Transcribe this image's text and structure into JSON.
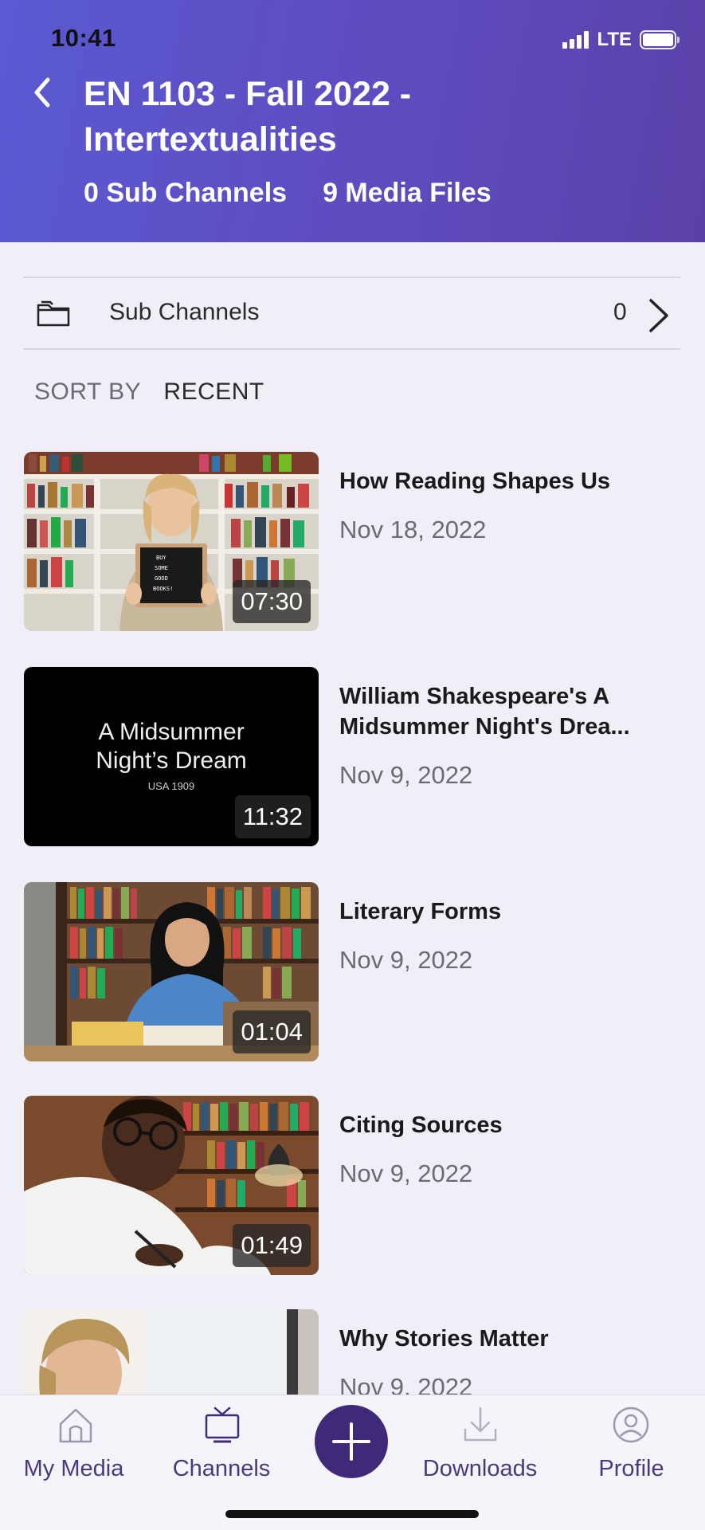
{
  "status_bar": {
    "time": "10:41",
    "network": "LTE"
  },
  "header": {
    "title": "EN 1103 - Fall 2022 - Intertextualities",
    "sub_channels_count_text": "0 Sub Channels",
    "media_files_count_text": "9 Media Files"
  },
  "sub_channels": {
    "label": "Sub Channels",
    "count": "0"
  },
  "sort": {
    "label": "SORT BY",
    "value": "RECENT"
  },
  "media": [
    {
      "title": "How Reading Shapes Us",
      "date": "Nov 18, 2022",
      "duration": "07:30"
    },
    {
      "title": "William Shakespeare's A Midsummer Night's Drea...",
      "date": "Nov 9, 2022",
      "duration": "11:32",
      "thumb_text": "A Midsummer Night’s Dream",
      "thumb_subtext": "USA 1909"
    },
    {
      "title": "Literary Forms",
      "date": "Nov 9, 2022",
      "duration": "01:04"
    },
    {
      "title": "Citing Sources",
      "date": "Nov 9, 2022",
      "duration": "01:49"
    },
    {
      "title": "Why Stories Matter",
      "date": "Nov 9, 2022"
    }
  ],
  "bottom_nav": {
    "items": [
      {
        "label": "My Media",
        "icon": "home-icon"
      },
      {
        "label": "Channels",
        "icon": "tv-icon"
      },
      {
        "label": "Downloads",
        "icon": "download-icon"
      },
      {
        "label": "Profile",
        "icon": "profile-icon"
      }
    ],
    "fab_icon": "plus-icon"
  },
  "colors": {
    "header_gradient_start": "#5a5ad2",
    "header_gradient_end": "#5a41a8",
    "background": "#f0eef7",
    "accent": "#3f2a7a",
    "nav_label": "#4a3a7c"
  }
}
